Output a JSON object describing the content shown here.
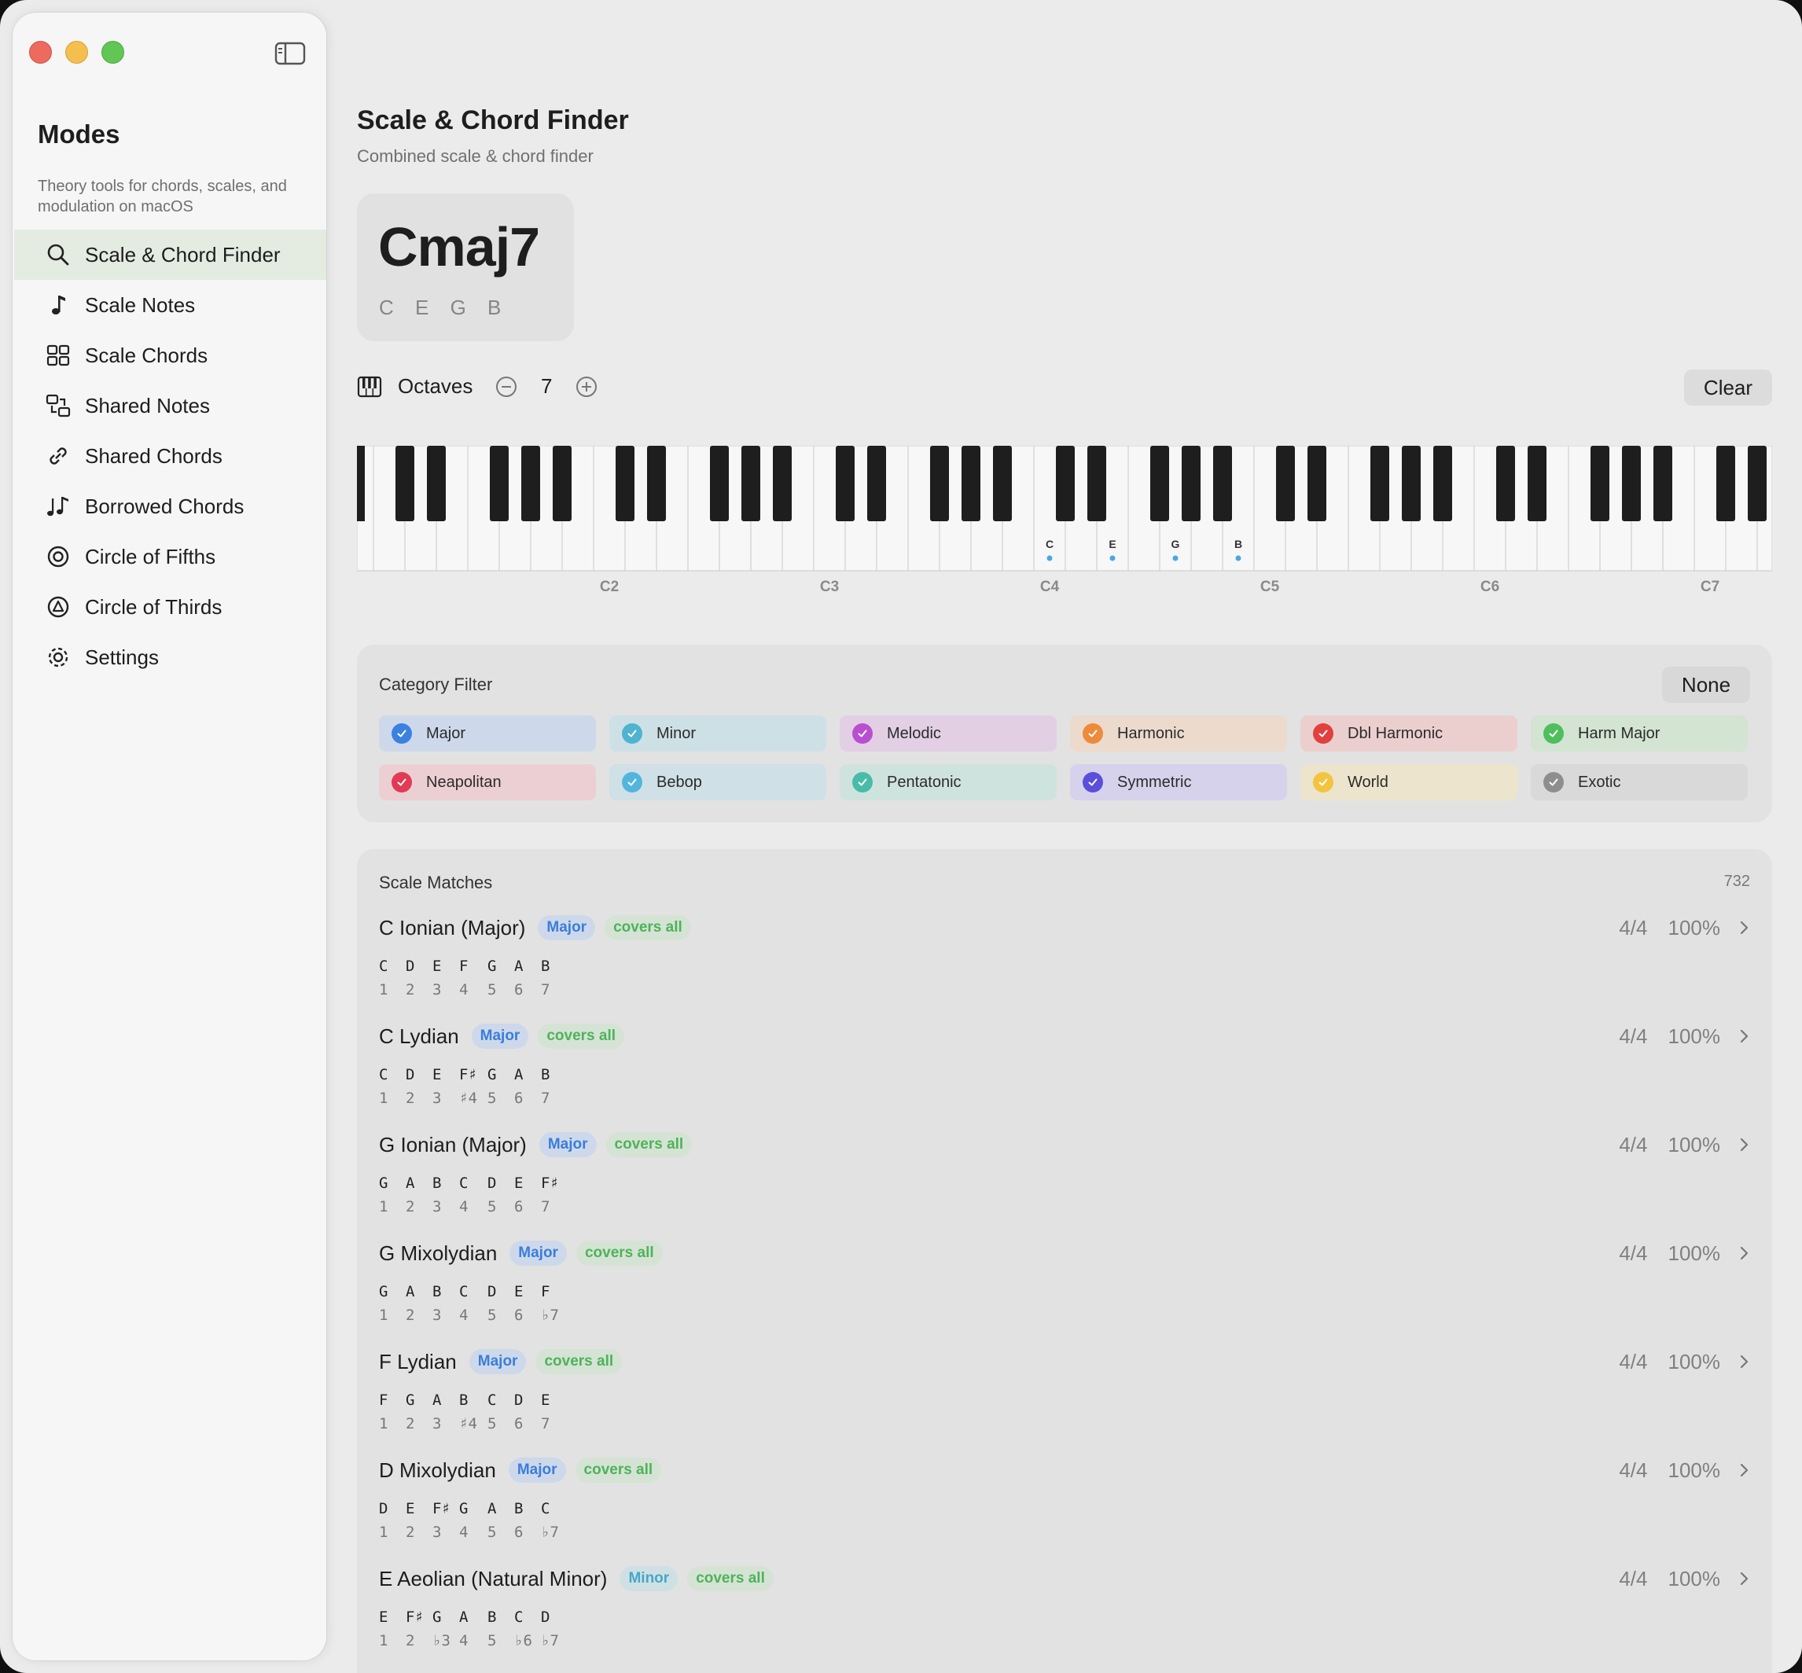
{
  "app": {
    "title": "Modes",
    "description": "Theory tools for chords, scales, and modulation on macOS"
  },
  "sidebar": {
    "items": [
      {
        "label": "Scale & Chord Finder",
        "icon": "magnifier-icon",
        "active": true
      },
      {
        "label": "Scale Notes",
        "icon": "music-note-icon"
      },
      {
        "label": "Scale Chords",
        "icon": "grid-icon"
      },
      {
        "label": "Shared Notes",
        "icon": "shared-notes-icon"
      },
      {
        "label": "Shared Chords",
        "icon": "link-icon"
      },
      {
        "label": "Borrowed Chords",
        "icon": "notes-icon"
      },
      {
        "label": "Circle of Fifths",
        "icon": "circle-icon"
      },
      {
        "label": "Circle of Thirds",
        "icon": "triangle-circle-icon"
      },
      {
        "label": "Settings",
        "icon": "gear-icon"
      }
    ]
  },
  "header": {
    "title": "Scale & Chord Finder",
    "subtitle": "Combined scale & chord finder"
  },
  "chord": {
    "name": "Cmaj7",
    "notes": "C E G B"
  },
  "octaves": {
    "label": "Octaves",
    "value": "7",
    "clear_label": "Clear"
  },
  "keyboard": {
    "octave_labels": [
      "C2",
      "C3",
      "C4",
      "C5",
      "C6",
      "C7"
    ],
    "selected_notes": [
      "C",
      "E",
      "G",
      "B"
    ],
    "accent": "#4aa8e0"
  },
  "filter": {
    "title": "Category Filter",
    "none_label": "None",
    "categories": [
      {
        "label": "Major",
        "bg": "#cdd9eb",
        "check": "#3b82e0"
      },
      {
        "label": "Minor",
        "bg": "#cde0e6",
        "check": "#4eb4cf"
      },
      {
        "label": "Melodic",
        "bg": "#e2cfe4",
        "check": "#b94fd0"
      },
      {
        "label": "Harmonic",
        "bg": "#ecdacd",
        "check": "#ee8a3c"
      },
      {
        "label": "Dbl Harmonic",
        "bg": "#ebcfcf",
        "check": "#e0413f"
      },
      {
        "label": "Harm Major",
        "bg": "#d3e4d2",
        "check": "#4fbf5e"
      },
      {
        "label": "Neapolitan",
        "bg": "#ebcfd3",
        "check": "#e23a55"
      },
      {
        "label": "Bebop",
        "bg": "#cfe0e6",
        "check": "#52b6dc"
      },
      {
        "label": "Pentatonic",
        "bg": "#cfe3de",
        "check": "#48bca8"
      },
      {
        "label": "Symmetric",
        "bg": "#d6d2ec",
        "check": "#5b4fd9"
      },
      {
        "label": "World",
        "bg": "#ece4cc",
        "check": "#f3c43f"
      },
      {
        "label": "Exotic",
        "bg": "#d9d9d9",
        "check": "#8e8e8e"
      }
    ]
  },
  "matches": {
    "title": "Scale Matches",
    "count": "732",
    "items": [
      {
        "name": "C Ionian (Major)",
        "type": "Major",
        "coverage": "covers all",
        "ratio": "4/4",
        "percent": "100%",
        "notes": [
          "C",
          "D",
          "E",
          "F",
          "G",
          "A",
          "B"
        ],
        "degrees": [
          "1",
          "2",
          "3",
          "4",
          "5",
          "6",
          "7"
        ]
      },
      {
        "name": "C Lydian",
        "type": "Major",
        "coverage": "covers all",
        "ratio": "4/4",
        "percent": "100%",
        "notes": [
          "C",
          "D",
          "E",
          "F♯",
          "G",
          "A",
          "B"
        ],
        "degrees": [
          "1",
          "2",
          "3",
          "♯4",
          "5",
          "6",
          "7"
        ]
      },
      {
        "name": "G Ionian (Major)",
        "type": "Major",
        "coverage": "covers all",
        "ratio": "4/4",
        "percent": "100%",
        "notes": [
          "G",
          "A",
          "B",
          "C",
          "D",
          "E",
          "F♯"
        ],
        "degrees": [
          "1",
          "2",
          "3",
          "4",
          "5",
          "6",
          "7"
        ]
      },
      {
        "name": "G Mixolydian",
        "type": "Major",
        "coverage": "covers all",
        "ratio": "4/4",
        "percent": "100%",
        "notes": [
          "G",
          "A",
          "B",
          "C",
          "D",
          "E",
          "F"
        ],
        "degrees": [
          "1",
          "2",
          "3",
          "4",
          "5",
          "6",
          "♭7"
        ]
      },
      {
        "name": "F Lydian",
        "type": "Major",
        "coverage": "covers all",
        "ratio": "4/4",
        "percent": "100%",
        "notes": [
          "F",
          "G",
          "A",
          "B",
          "C",
          "D",
          "E"
        ],
        "degrees": [
          "1",
          "2",
          "3",
          "♯4",
          "5",
          "6",
          "7"
        ]
      },
      {
        "name": "D Mixolydian",
        "type": "Major",
        "coverage": "covers all",
        "ratio": "4/4",
        "percent": "100%",
        "notes": [
          "D",
          "E",
          "F♯",
          "G",
          "A",
          "B",
          "C"
        ],
        "degrees": [
          "1",
          "2",
          "3",
          "4",
          "5",
          "6",
          "♭7"
        ]
      },
      {
        "name": "E Aeolian (Natural Minor)",
        "type": "Minor",
        "coverage": "covers all",
        "ratio": "4/4",
        "percent": "100%",
        "notes": [
          "E",
          "F♯",
          "G",
          "A",
          "B",
          "C",
          "D"
        ],
        "degrees": [
          "1",
          "2",
          "♭3",
          "4",
          "5",
          "♭6",
          "♭7"
        ]
      }
    ]
  }
}
